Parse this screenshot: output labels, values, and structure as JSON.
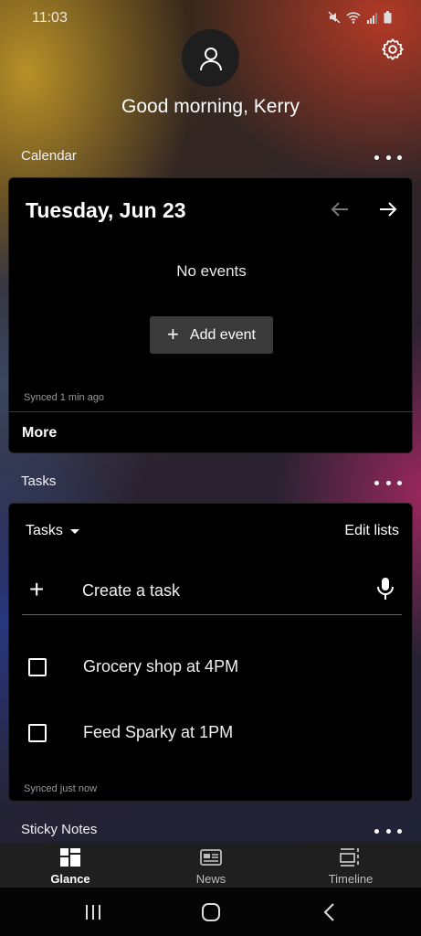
{
  "status_bar": {
    "time": "11:03",
    "icons": [
      "mute-icon",
      "wifi-icon",
      "signal-icon",
      "battery-icon"
    ]
  },
  "header": {
    "greeting": "Good morning, Kerry",
    "avatar_icon": "person-icon",
    "settings_icon": "gear-icon"
  },
  "calendar": {
    "section_title": "Calendar",
    "date": "Tuesday, Jun 23",
    "empty_text": "No events",
    "add_button_label": "Add event",
    "synced_text": "Synced 1 min ago",
    "more_label": "More"
  },
  "tasks": {
    "section_title": "Tasks",
    "list_selector": "Tasks",
    "edit_lists_label": "Edit lists",
    "create_placeholder": "Create a task",
    "items": [
      {
        "text": "Grocery shop at 4PM",
        "checked": false
      },
      {
        "text": "Feed Sparky at 1PM",
        "checked": false
      }
    ],
    "synced_text": "Synced just now"
  },
  "sticky_notes": {
    "section_title": "Sticky Notes"
  },
  "bottom_nav": {
    "items": [
      {
        "label": "Glance",
        "icon": "glance-grid-icon",
        "active": true
      },
      {
        "label": "News",
        "icon": "newspaper-icon",
        "active": false
      },
      {
        "label": "Timeline",
        "icon": "timeline-icon",
        "active": false
      }
    ]
  },
  "colors": {
    "card_bg": "#000000",
    "button_bg": "#3a3a3a",
    "nav_bg": "#1f1f1f",
    "muted_text": "#9a9a9a"
  }
}
